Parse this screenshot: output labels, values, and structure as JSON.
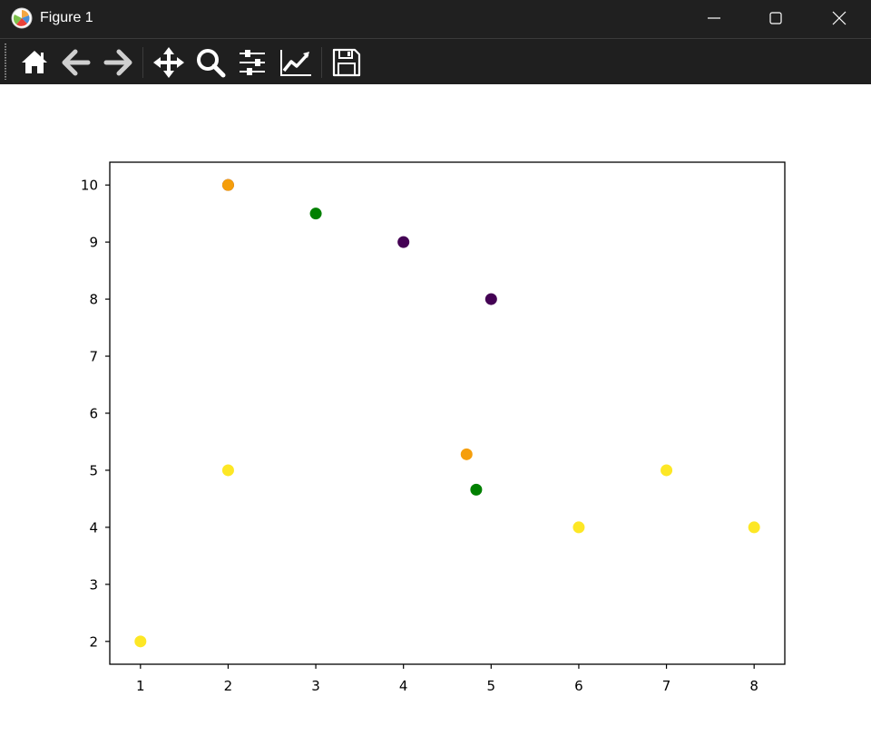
{
  "window": {
    "title": "Figure 1"
  },
  "titlebar_buttons": [
    {
      "name": "minimize-button",
      "icon": "minimize-icon"
    },
    {
      "name": "maximize-button",
      "icon": "maximize-icon"
    },
    {
      "name": "close-button",
      "icon": "close-icon"
    }
  ],
  "toolbar": {
    "tools": [
      {
        "name": "home-button",
        "icon": "home-icon"
      },
      {
        "name": "back-button",
        "icon": "arrow-left-icon"
      },
      {
        "name": "forward-button",
        "icon": "arrow-right-icon"
      },
      {
        "name": "pan-button",
        "icon": "move-icon"
      },
      {
        "name": "zoom-button",
        "icon": "magnifier-icon"
      },
      {
        "name": "configure-subplots-button",
        "icon": "sliders-icon"
      },
      {
        "name": "edit-axis-button",
        "icon": "line-chart-icon"
      },
      {
        "name": "save-button",
        "icon": "floppy-disk-icon"
      }
    ]
  },
  "colors": {
    "titlebar_bg": "#202020",
    "toolbar_bg": "#1f1f1f",
    "yellow": "#fde725",
    "orange": "#f59e0b",
    "green": "#008000",
    "purple": "#440154"
  },
  "chart_data": {
    "type": "scatter",
    "title": "",
    "xlabel": "",
    "ylabel": "",
    "xlim": [
      0.65,
      8.35
    ],
    "ylim": [
      1.6,
      10.4
    ],
    "xticks": [
      1,
      2,
      3,
      4,
      5,
      6,
      7,
      8
    ],
    "yticks": [
      2,
      3,
      4,
      5,
      6,
      7,
      8,
      9,
      10
    ],
    "grid": false,
    "points": [
      {
        "x": 1,
        "y": 2,
        "color": "#fde725"
      },
      {
        "x": 2,
        "y": 5,
        "color": "#fde725"
      },
      {
        "x": 2,
        "y": 10,
        "color": "#440154"
      },
      {
        "x": 2,
        "y": 10,
        "color": "#f59e0b"
      },
      {
        "x": 3,
        "y": 9.5,
        "color": "#008000"
      },
      {
        "x": 4,
        "y": 9,
        "color": "#440154"
      },
      {
        "x": 5,
        "y": 8,
        "color": "#440154"
      },
      {
        "x": 4.72,
        "y": 5.28,
        "color": "#f59e0b"
      },
      {
        "x": 4.83,
        "y": 4.66,
        "color": "#008000"
      },
      {
        "x": 6,
        "y": 4,
        "color": "#fde725"
      },
      {
        "x": 7,
        "y": 5,
        "color": "#fde725"
      },
      {
        "x": 8,
        "y": 4,
        "color": "#fde725"
      }
    ]
  }
}
